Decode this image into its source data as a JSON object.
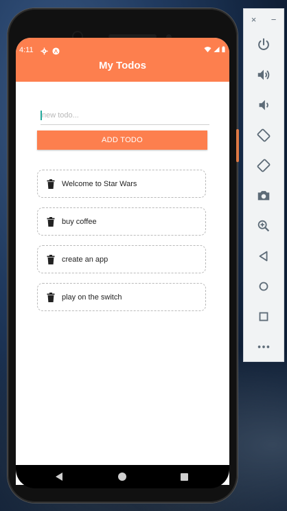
{
  "status_bar": {
    "time": "4:11"
  },
  "app": {
    "title": "My Todos",
    "input_placeholder": "new todo...",
    "add_button_label": "ADD TODO",
    "accent_color": "#fd7f4e"
  },
  "todos": [
    {
      "text": "Welcome to Star Wars"
    },
    {
      "text": "buy coffee"
    },
    {
      "text": "create an app"
    },
    {
      "text": "play on the switch"
    }
  ],
  "emulator_panel": {
    "close_label": "×",
    "minimize_label": "−",
    "buttons": [
      {
        "icon": "power-icon"
      },
      {
        "icon": "volume-up-icon"
      },
      {
        "icon": "volume-down-icon"
      },
      {
        "icon": "rotate-left-icon"
      },
      {
        "icon": "rotate-right-icon"
      },
      {
        "icon": "camera-icon"
      },
      {
        "icon": "zoom-icon"
      },
      {
        "icon": "back-icon"
      },
      {
        "icon": "home-icon"
      },
      {
        "icon": "overview-icon"
      },
      {
        "icon": "more-icon"
      }
    ]
  }
}
